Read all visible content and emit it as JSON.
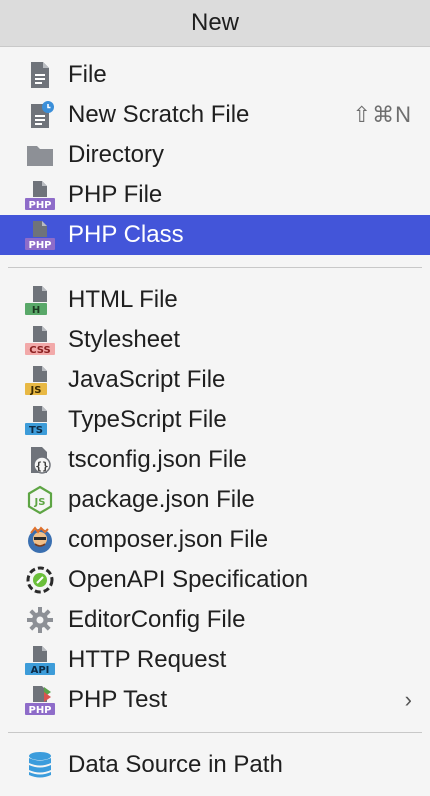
{
  "popup": {
    "title": "New"
  },
  "groups": [
    [
      {
        "label": "File",
        "icon": "file-icon"
      },
      {
        "label": "New Scratch File",
        "icon": "scratch-file-icon",
        "shortcut": "⇧⌘N"
      },
      {
        "label": "Directory",
        "icon": "folder-icon"
      },
      {
        "label": "PHP File",
        "icon": "php-file-icon"
      },
      {
        "label": "PHP Class",
        "icon": "php-class-icon",
        "selected": true
      }
    ],
    [
      {
        "label": "HTML File",
        "icon": "html-file-icon"
      },
      {
        "label": "Stylesheet",
        "icon": "css-file-icon"
      },
      {
        "label": "JavaScript File",
        "icon": "js-file-icon"
      },
      {
        "label": "TypeScript File",
        "icon": "ts-file-icon"
      },
      {
        "label": "tsconfig.json File",
        "icon": "tsconfig-icon"
      },
      {
        "label": "package.json File",
        "icon": "nodejs-icon"
      },
      {
        "label": "composer.json File",
        "icon": "composer-icon"
      },
      {
        "label": "OpenAPI Specification",
        "icon": "openapi-icon"
      },
      {
        "label": "EditorConfig File",
        "icon": "gear-icon"
      },
      {
        "label": "HTTP Request",
        "icon": "api-icon"
      },
      {
        "label": "PHP Test",
        "icon": "php-test-icon",
        "submenu": true
      }
    ],
    [
      {
        "label": "Data Source in Path",
        "icon": "database-icon"
      }
    ]
  ],
  "colors": {
    "selection": "#4355d9",
    "php": "#8e6cc9",
    "html": "#59a869",
    "css": "#e05555",
    "js": "#e8b843",
    "ts": "#3d9cd9",
    "node": "#5ea544",
    "db": "#3b9cdc"
  },
  "submenu_chevron": "›"
}
